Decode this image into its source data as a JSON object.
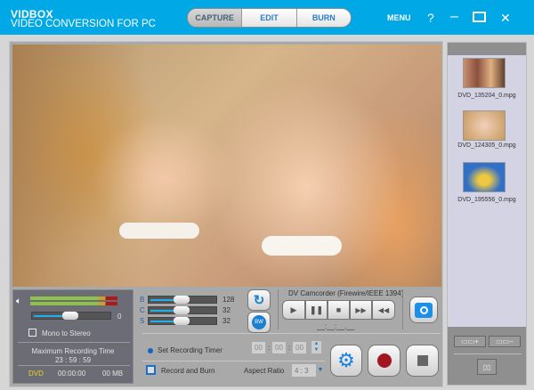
{
  "header": {
    "brand": "VIDBOX",
    "subtitle": "VIDEO CONVERSION FOR PC",
    "tabs": [
      "CAPTURE",
      "EDIT",
      "BURN"
    ],
    "menu": "MENU",
    "help": "?",
    "minimize": "–",
    "close": "✕"
  },
  "audio": {
    "volume_value": "0",
    "volume_percent": 55,
    "mono_label": "Mono to Stereo",
    "max_time_label": "Maximum Recording Time",
    "max_time": "23 : 59 : 59",
    "format": "DVD",
    "elapsed": "00:00:00",
    "size": "00 MB"
  },
  "adjust": {
    "items": [
      {
        "label": "B",
        "value": "128",
        "percent": 50
      },
      {
        "label": "C",
        "value": "32",
        "percent": 50
      },
      {
        "label": "S",
        "value": "32",
        "percent": 50
      }
    ]
  },
  "device": {
    "label": "DV Camcorder (Firewire/IEEE 1394)",
    "timecode": "__:__:__.__"
  },
  "timer": {
    "label": "Set Recording Timer",
    "h": "00",
    "m": "00",
    "s": "00"
  },
  "record": {
    "label": "Record and Burn",
    "aspect_label": "Aspect Ratio",
    "aspect_value": "4 : 3"
  },
  "files": [
    {
      "name": "DVD_135204_0.mpg"
    },
    {
      "name": "DVD_124305_0.mpg"
    },
    {
      "name": "DVD_195556_0.mpg"
    }
  ],
  "colors": {
    "brand_blue": "#00a9e6",
    "record_red": "#a3141e"
  }
}
